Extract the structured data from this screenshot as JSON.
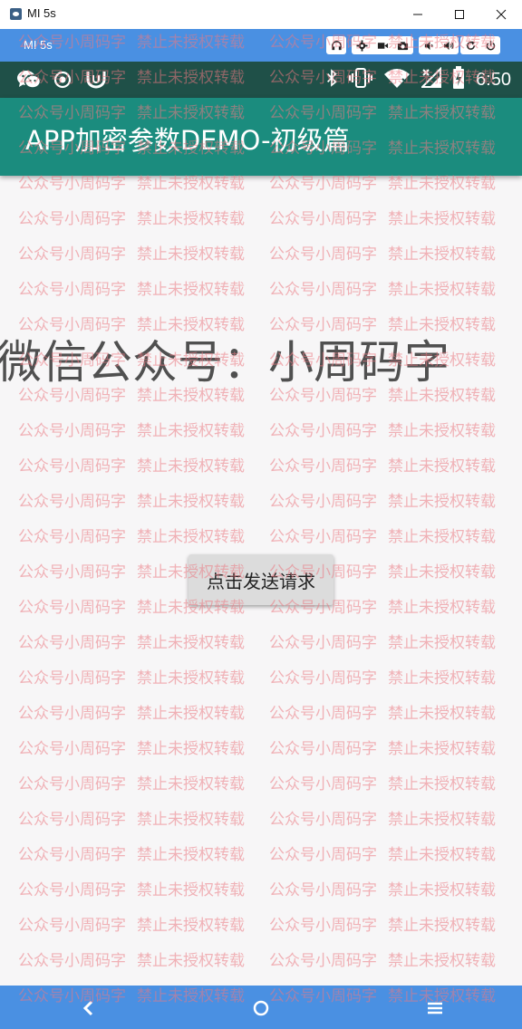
{
  "window": {
    "title": "MI 5s"
  },
  "emulator": {
    "device_name": "MI 5s",
    "buttons": [
      "headphones-icon",
      "settings-icon",
      "video-camera-icon",
      "camera-icon",
      "volume-down-icon",
      "volume-up-icon",
      "rotate-icon",
      "power-icon"
    ]
  },
  "status_bar": {
    "time": "6:50",
    "left_icons": [
      "wechat-icon",
      "record-icon",
      "app-icon"
    ],
    "right_icons": [
      "bluetooth-icon",
      "vibrate-icon",
      "wifi-icon",
      "no-signal-icon",
      "battery-charging-icon"
    ]
  },
  "app_bar": {
    "title": "APP加密参数DEMO-初级篇"
  },
  "content": {
    "headline": "微信公众号：小周码字",
    "send_button_label": "点击发送请求"
  },
  "watermark": {
    "text_a": "公众号小周码字",
    "text_b": "禁止未授权转载"
  },
  "colors": {
    "status_bar": "#1f5048",
    "app_bar": "#1b8c7e",
    "emulator_bar": "#4a90e2",
    "content_bg": "#f7f6f7",
    "watermark": "#eb7882"
  }
}
